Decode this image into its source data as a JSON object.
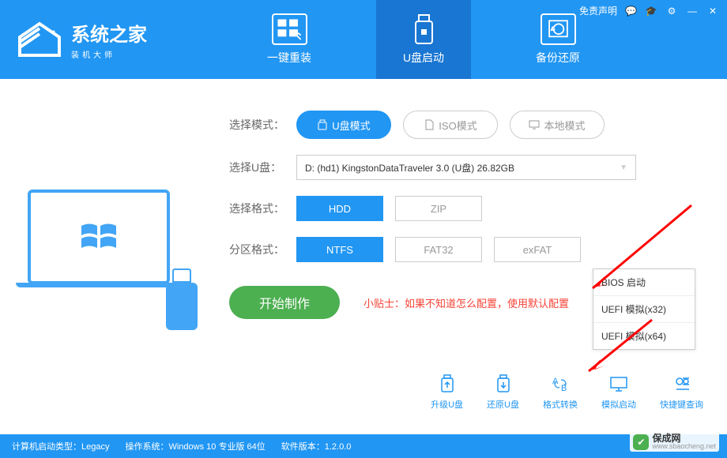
{
  "header": {
    "logo_title": "系统之家",
    "logo_sub": "装机大师",
    "disclaimer": "免责声明",
    "tabs": [
      "一键重装",
      "U盘启动",
      "备份还原"
    ],
    "active_tab": 1
  },
  "form": {
    "mode_label": "选择模式：",
    "modes": [
      "U盘模式",
      "ISO模式",
      "本地模式"
    ],
    "usb_label": "选择U盘：",
    "usb_value": "D: (hd1) KingstonDataTraveler 3.0 (U盘) 26.82GB",
    "fmt_label": "选择格式：",
    "fmts": [
      "HDD",
      "ZIP"
    ],
    "part_label": "分区格式：",
    "parts": [
      "NTFS",
      "FAT32",
      "exFAT"
    ],
    "start_label": "开始制作",
    "tip": "小贴士：如果不知道怎么配置，使用默认配置"
  },
  "popup": [
    "BIOS 启动",
    "UEFI 模拟(x32)",
    "UEFI 模拟(x64)"
  ],
  "bottom_actions": [
    "升级U盘",
    "还原U盘",
    "格式转换",
    "模拟启动",
    "快捷键查询"
  ],
  "statusbar": {
    "boot_type": "计算机启动类型：Legacy",
    "os": "操作系统：Windows 10 专业版 64位",
    "version": "软件版本：1.2.0.0"
  },
  "watermark": {
    "cn": "保成网",
    "url": "www.sbaocheng.net"
  }
}
